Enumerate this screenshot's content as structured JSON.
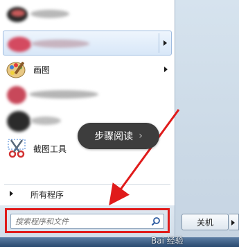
{
  "start_menu": {
    "items": [
      {
        "label": "",
        "icon": "blurred-app-icon"
      },
      {
        "label": "",
        "icon": "blurred-app-icon",
        "selected": true,
        "has_submenu": true
      },
      {
        "label": "画图",
        "icon": "paint-icon",
        "has_submenu": true
      },
      {
        "label": "",
        "icon": "blurred-app-icon"
      },
      {
        "label": "",
        "icon": "blurred-app-icon"
      },
      {
        "label": "截图工具",
        "icon": "snipping-tool-icon"
      }
    ],
    "all_programs_label": "所有程序",
    "search": {
      "placeholder": "搜索程序和文件",
      "value": ""
    },
    "shutdown_label": "关机"
  },
  "tooltip": {
    "text": "步骤阅读",
    "chevron": "›"
  },
  "watermark": {
    "text": "Bai 经验"
  },
  "colors": {
    "highlight": "#e01b1b",
    "bubble": "#3d3d3d"
  }
}
